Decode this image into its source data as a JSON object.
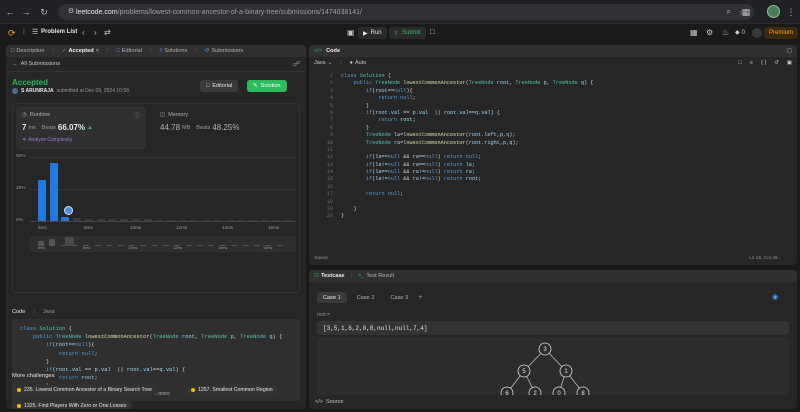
{
  "browser": {
    "url_host": "leetcode.com",
    "url_path": "/problems/lowest-common-ancestor-of-a-binary-tree/submissions/1474038141/"
  },
  "topbar": {
    "problem_list": "Problem List",
    "run": "Run",
    "submit": "Submit",
    "streak": "0",
    "premium": "Premium"
  },
  "left_tabs": [
    "Description",
    "Accepted",
    "Editorial",
    "Solutions",
    "Submissions"
  ],
  "submission": {
    "back": "All Submissions",
    "status": "Accepted",
    "user": "S ARUNRAJA",
    "submitted_at": "submitted at Dec 09, 2024 10:58",
    "editorial_btn": "Editorial",
    "solution_btn": "Solution",
    "runtime_label": "Runtime",
    "runtime_value": "7",
    "runtime_unit": "ms",
    "beats_label": "Beats",
    "runtime_beats": "66.07%",
    "analyze": "Analyze Complexity",
    "memory_label": "Memory",
    "memory_value": "44.78",
    "memory_unit": "MB",
    "memory_beats": "48.25%"
  },
  "chart_data": {
    "type": "bar",
    "y_ticks": [
      "50%",
      "25%",
      "0%"
    ],
    "x_ticks": [
      "6ms",
      "8ms",
      "10ms",
      "12ms",
      "14ms",
      "16ms"
    ],
    "mini_ticks": [
      "6ms",
      "8ms",
      "10ms",
      "12ms",
      "14ms",
      "16ms"
    ],
    "values": [
      32,
      45,
      3,
      2,
      1.5,
      1.5,
      1.2,
      1.2,
      1.2,
      1.2,
      1,
      1,
      1,
      1,
      1,
      1,
      1,
      1,
      1,
      1,
      1,
      1
    ],
    "highlight_index": 1,
    "ylim": [
      0,
      50
    ]
  },
  "code_section": {
    "label": "Code",
    "lang": "Java",
    "view_more": "View more"
  },
  "more_challenges": {
    "title": "More challenges",
    "items": [
      "235. Lowest Common Ancestor of a Binary Search Tree",
      "1257. Smallest Common Region",
      "1325. Find Players With Zero or One Losses"
    ]
  },
  "editor": {
    "tab": "Code",
    "lang": "Java",
    "mode": "Auto",
    "status_left": "Saved",
    "status_right": "Ln 15, Col 46"
  },
  "code_lines": [
    "class Solution {",
    "    public TreeNode lowestCommonAncestor(TreeNode root, TreeNode p, TreeNode q) {",
    "        if(root==null){",
    "            return null;",
    "        }",
    "        if(root.val == p.val  || root.val==q.val) {",
    "            return root;",
    "        }",
    "        TreeNode la=lowestCommonAncestor(root.left,p,q);",
    "        TreeNode ra=lowestCommonAncestor(root.right,p,q);",
    "",
    "        if(la==null && ra==null) return null;",
    "        if(la!=null && ra==null) return la;",
    "        if(la==null && ra!=null) return ra;",
    "        if(la!=null && ra!=null) return root;",
    "",
    "        return null;",
    "",
    "    }",
    "}"
  ],
  "left_code_lines": [
    "class Solution {",
    "    public TreeNode lowestCommonAncestor(TreeNode root, TreeNode p, TreeNode q) {",
    "        if(root==null){",
    "            return null;",
    "        }",
    "        if(root.val == p.val  || root.val==q.val) {",
    "            return root;",
    "        }"
  ],
  "testcase": {
    "tab": "Testcase",
    "result_tab": "Test Result",
    "cases": [
      "Case 1",
      "Case 2",
      "Case 3"
    ],
    "input_label": "root =",
    "input_value": "[3,5,1,6,2,0,8,null,null,7,4]",
    "source": "Source",
    "tree_nodes": [
      "3",
      "5",
      "1",
      "6",
      "2",
      "0",
      "8"
    ]
  }
}
